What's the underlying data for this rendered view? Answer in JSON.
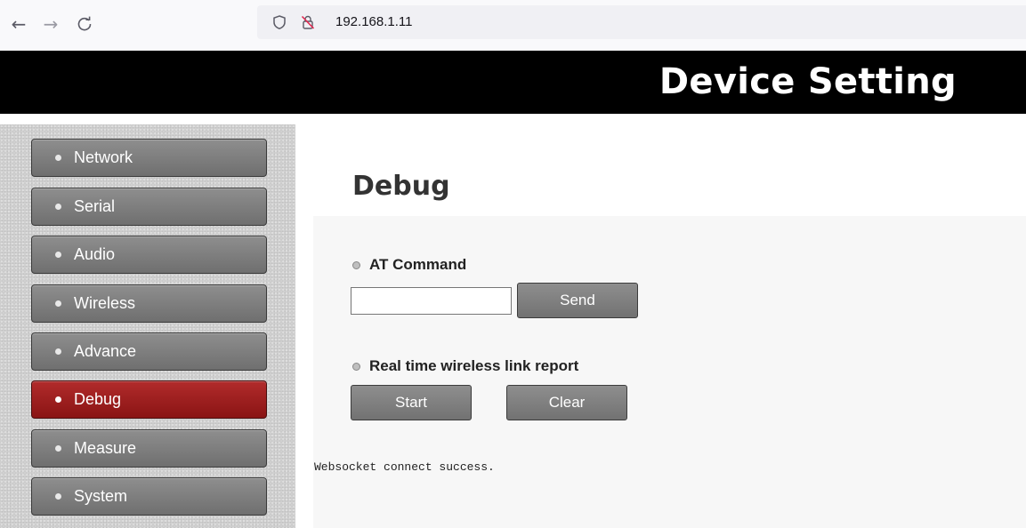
{
  "browser": {
    "back_icon": "←",
    "forward_icon": "→",
    "reload_icon": "C",
    "url": "192.168.1.11"
  },
  "header": {
    "title": "Device Setting"
  },
  "sidebar": {
    "items": [
      {
        "label": "Network"
      },
      {
        "label": "Serial"
      },
      {
        "label": "Audio"
      },
      {
        "label": "Wireless"
      },
      {
        "label": "Advance"
      },
      {
        "label": "Debug",
        "active": true
      },
      {
        "label": "Measure"
      },
      {
        "label": "System"
      }
    ]
  },
  "main": {
    "title": "Debug",
    "at_command": {
      "label": "AT Command",
      "input_value": "",
      "send_label": "Send"
    },
    "report": {
      "label": "Real time wireless link report",
      "start_label": "Start",
      "clear_label": "Clear"
    },
    "log_text": "Websocket connect success."
  },
  "colors": {
    "header_bg": "#000000",
    "active_item": "#a01f1f",
    "button_gray": "#808080",
    "panel_bg": "#f7f7f7"
  }
}
